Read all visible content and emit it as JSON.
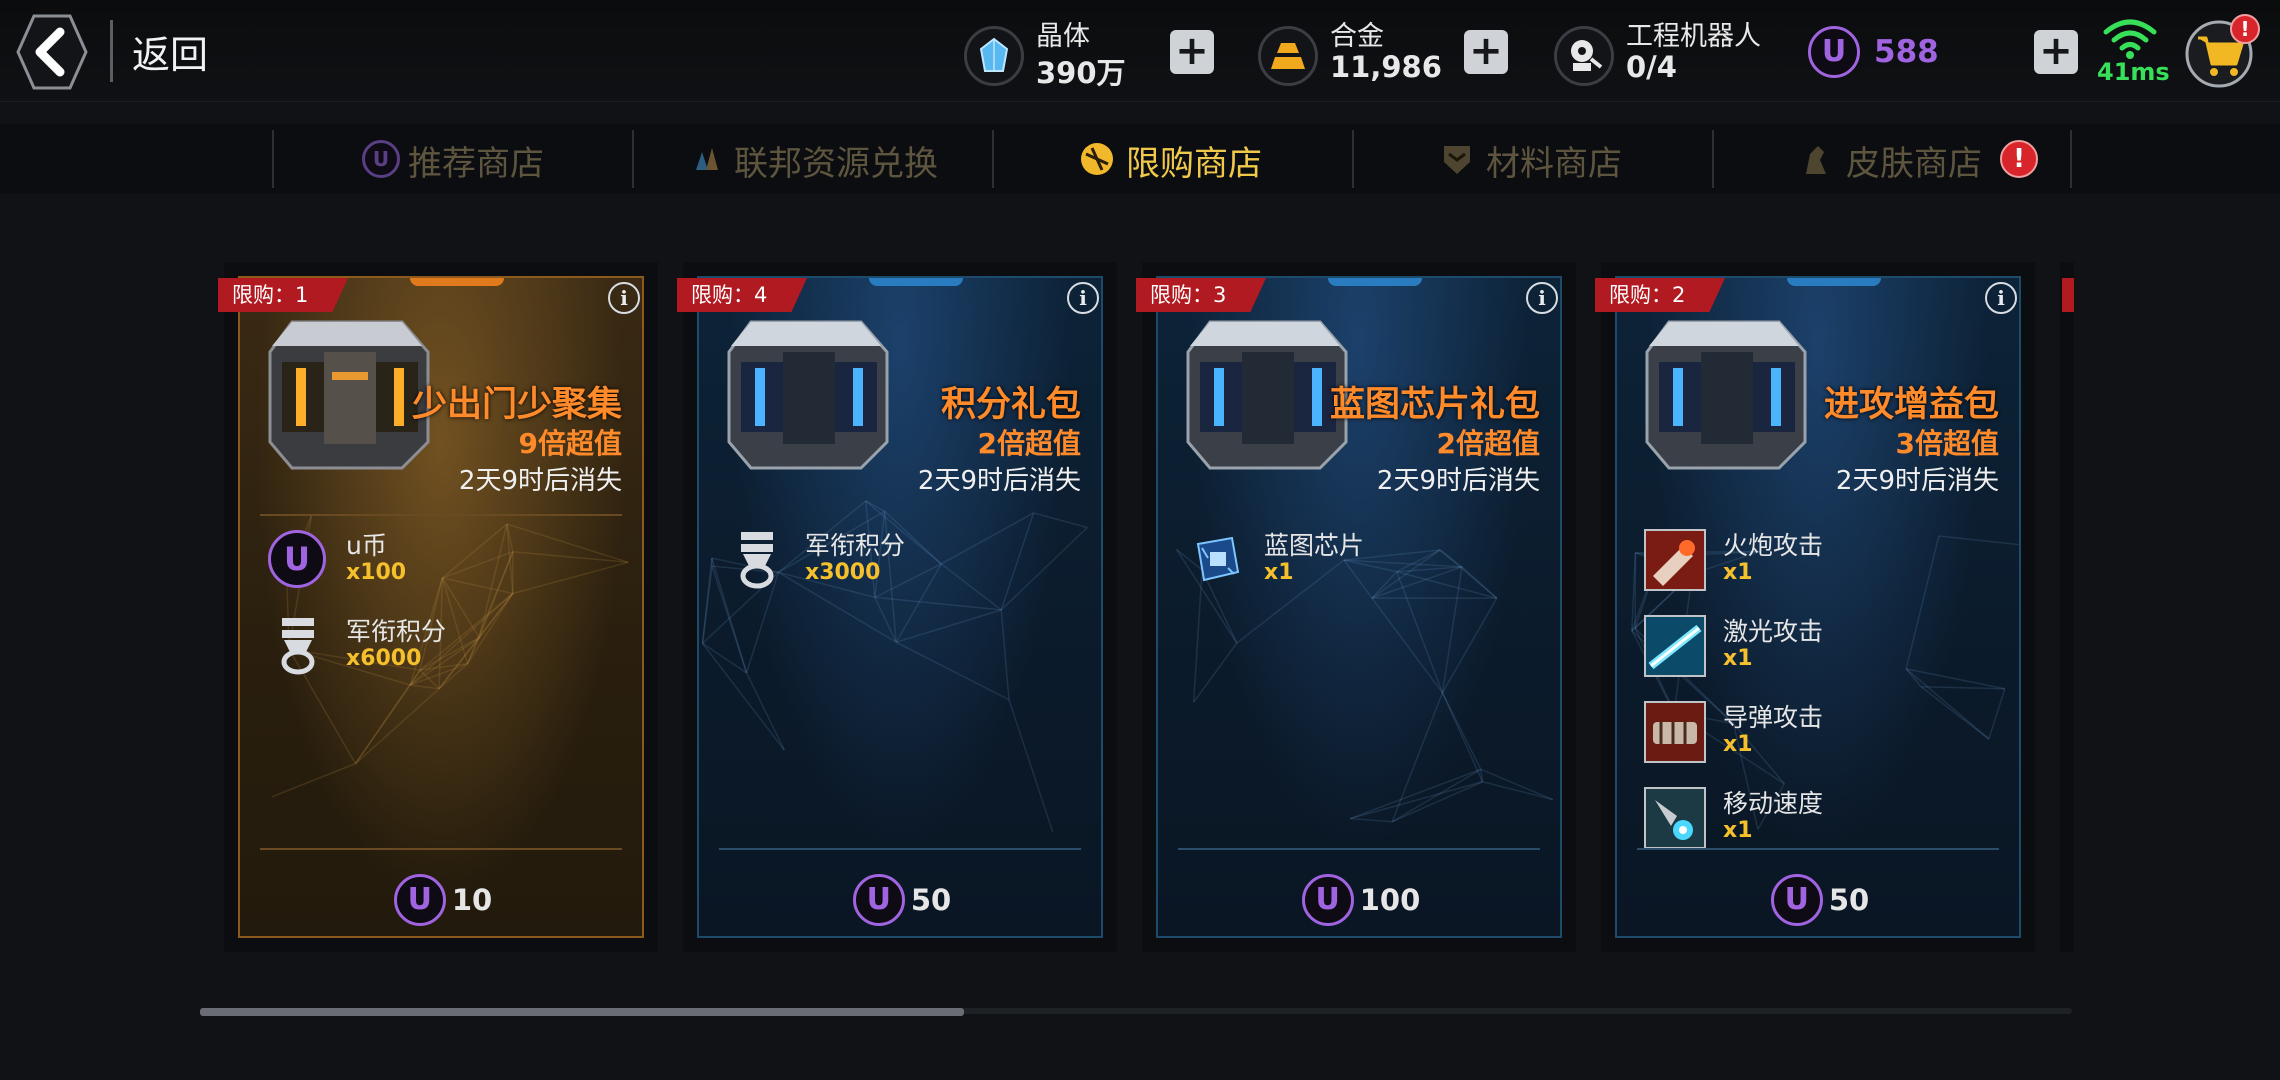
{
  "header": {
    "back_label": "返回",
    "resources": [
      {
        "name": "晶体",
        "value": "390万",
        "icon": "crystal-icon"
      },
      {
        "name": "合金",
        "value": "11,986",
        "icon": "alloy-icon"
      },
      {
        "name": "工程机器人",
        "value": "0/4",
        "icon": "robot-icon"
      }
    ],
    "ucoin": {
      "symbol": "U",
      "value": "588"
    },
    "plus_symbol": "+",
    "network": {
      "ping": "41ms"
    },
    "cart_badge": "!"
  },
  "tabs": [
    {
      "label": "推荐商店",
      "icon": "u-coin-icon",
      "active": false
    },
    {
      "label": "联邦资源兑换",
      "icon": "resource-icon",
      "active": false
    },
    {
      "label": "限购商店",
      "icon": "limited-shop-icon",
      "active": true
    },
    {
      "label": "材料商店",
      "icon": "material-icon",
      "active": false
    },
    {
      "label": "皮肤商店",
      "icon": "skin-icon",
      "active": false,
      "badge": "!"
    }
  ],
  "cards": [
    {
      "limit": "限购：1",
      "info": "i",
      "title": "少出门少聚集",
      "value": "9倍超值",
      "expire": "2天9时后消失",
      "theme": "gold",
      "items": [
        {
          "name": "u币",
          "qty": "x100",
          "icon": "u-coin-icon"
        },
        {
          "name": "军衔积分",
          "qty": "x6000",
          "icon": "rank-medal-icon"
        }
      ],
      "price": "10",
      "price_symbol": "U"
    },
    {
      "limit": "限购：4",
      "info": "i",
      "title": "积分礼包",
      "value": "2倍超值",
      "expire": "2天9时后消失",
      "theme": "blue",
      "items": [
        {
          "name": "军衔积分",
          "qty": "x3000",
          "icon": "rank-medal-icon"
        }
      ],
      "price": "50",
      "price_symbol": "U"
    },
    {
      "limit": "限购：3",
      "info": "i",
      "title": "蓝图芯片礼包",
      "value": "2倍超值",
      "expire": "2天9时后消失",
      "theme": "blue",
      "items": [
        {
          "name": "蓝图芯片",
          "qty": "x1",
          "icon": "blueprint-chip-icon"
        }
      ],
      "price": "100",
      "price_symbol": "U"
    },
    {
      "limit": "限购：2",
      "info": "i",
      "title": "进攻增益包",
      "value": "3倍超值",
      "expire": "2天9时后消失",
      "theme": "blue",
      "items": [
        {
          "name": "火炮攻击",
          "qty": "x1",
          "icon": "cannon-attack-icon"
        },
        {
          "name": "激光攻击",
          "qty": "x1",
          "icon": "laser-attack-icon"
        },
        {
          "name": "导弹攻击",
          "qty": "x1",
          "icon": "missile-attack-icon"
        },
        {
          "name": "移动速度",
          "qty": "x1",
          "icon": "move-speed-icon"
        }
      ],
      "price": "50",
      "price_symbol": "U"
    }
  ],
  "colors": {
    "accent_gold": "#f0c94a",
    "title_orange": "#ff8a2a",
    "ucoin_purple": "#a064e0",
    "qty_yellow": "#f5c02c",
    "limit_red": "#b11a20",
    "ping_green": "#38e05a"
  },
  "scroll": {
    "position_fraction": 0.41
  }
}
